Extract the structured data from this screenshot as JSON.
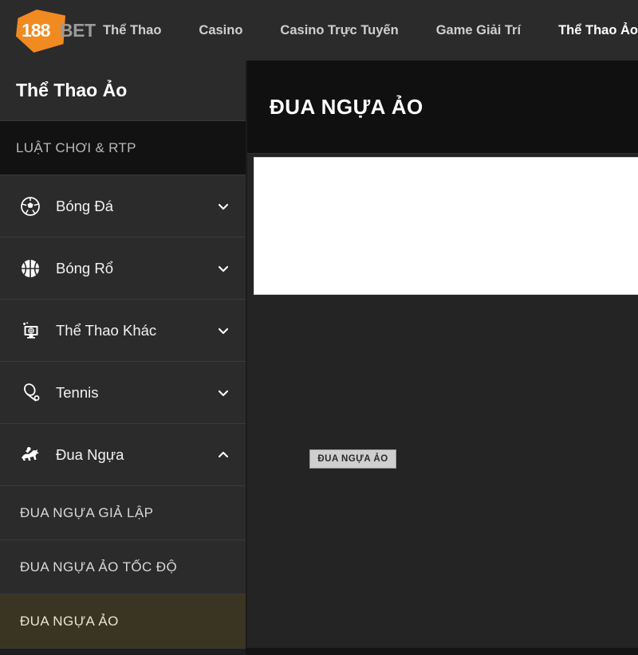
{
  "brand": {
    "logo_primary": "188",
    "logo_secondary": "BET",
    "accent_color": "#F18A21"
  },
  "topnav": {
    "items": [
      {
        "label": "Thể Thao",
        "active": false
      },
      {
        "label": "Casino",
        "active": false
      },
      {
        "label": "Casino Trực Tuyến",
        "active": false
      },
      {
        "label": "Game Giải Trí",
        "active": false
      },
      {
        "label": "Thể Thao Ảo",
        "active": true
      }
    ]
  },
  "sidebar": {
    "title": "Thể Thao Ảo",
    "rules_item": {
      "label": "LUẬT CHƠI & RTP"
    },
    "items": [
      {
        "label": "Bóng Đá",
        "icon": "soccer-ball-icon",
        "chevron": "chevron-down-icon",
        "expanded": false
      },
      {
        "label": "Bóng Rổ",
        "icon": "basketball-icon",
        "chevron": "chevron-down-icon",
        "expanded": false
      },
      {
        "label": "Thể Thao Khác",
        "icon": "monitor-sports-icon",
        "chevron": "chevron-down-icon",
        "expanded": false
      },
      {
        "label": "Tennis",
        "icon": "tennis-racket-icon",
        "chevron": "chevron-down-icon",
        "expanded": false
      },
      {
        "label": "Đua Ngựa",
        "icon": "horse-racing-icon",
        "chevron": "chevron-up-icon",
        "expanded": true
      }
    ],
    "subitems": [
      {
        "label": "ĐUA NGỰA GIẢ LẬP",
        "selected": false
      },
      {
        "label": "ĐUA NGỰA ẢO TỐC ĐỘ",
        "selected": false
      },
      {
        "label": "ĐUA NGỰA ẢO",
        "selected": true
      }
    ],
    "selected_highlight_color": "#3a3422"
  },
  "main": {
    "header_title": "ĐUA NGỰA ẢO",
    "stage_button_label": "ĐUA NGỰA ẢO"
  }
}
